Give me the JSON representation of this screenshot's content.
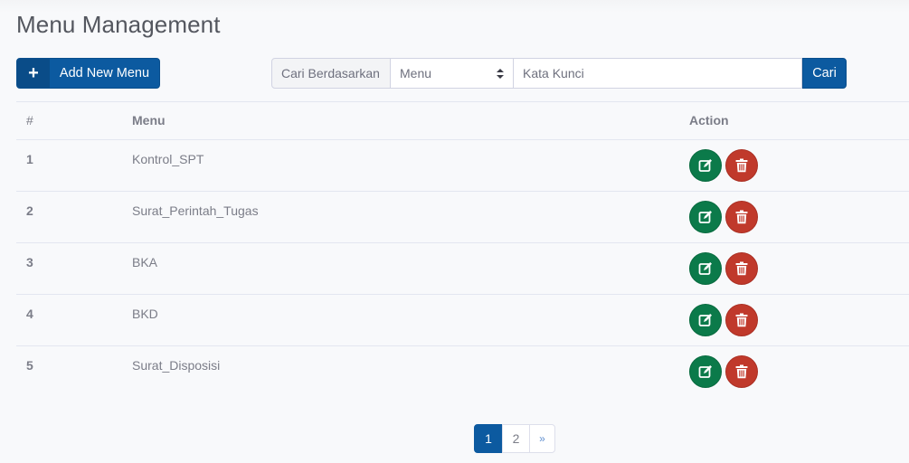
{
  "page": {
    "title": "Menu Management"
  },
  "toolbar": {
    "add_button": {
      "icon": "plus-icon",
      "icon_glyph": "+",
      "label": "Add New Menu"
    },
    "search": {
      "prefix_label": "Cari Berdasarkan",
      "field_select": {
        "selected": "Menu"
      },
      "keyword_input": {
        "value": "",
        "placeholder": "Kata Kunci"
      },
      "submit_label": "Cari"
    }
  },
  "table": {
    "columns": [
      "#",
      "Menu",
      "",
      "Action"
    ],
    "rows": [
      {
        "num": "1",
        "menu": "Kontrol_SPT"
      },
      {
        "num": "2",
        "menu": "Surat_Perintah_Tugas"
      },
      {
        "num": "3",
        "menu": "BKA"
      },
      {
        "num": "4",
        "menu": "BKD"
      },
      {
        "num": "5",
        "menu": "Surat_Disposisi"
      }
    ],
    "row_actions": {
      "edit_icon": "edit-icon",
      "delete_icon": "trash-icon"
    }
  },
  "pagination": {
    "pages": [
      "1",
      "2"
    ],
    "active_page": "1",
    "next_label": "»"
  },
  "colors": {
    "primary": "#0c5aa0",
    "success": "#0b7a4a",
    "danger": "#c0392b",
    "background": "#f8f9fb"
  }
}
